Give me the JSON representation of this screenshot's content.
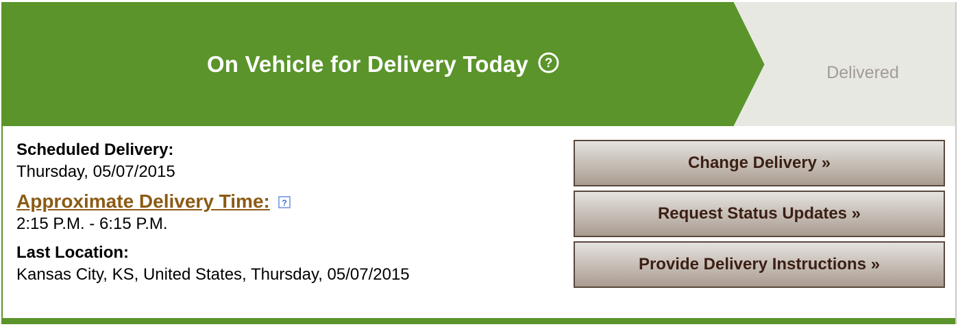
{
  "progress": {
    "current_status": "On Vehicle for Delivery Today",
    "next_status": "Delivered"
  },
  "details": {
    "scheduled_delivery_label": "Scheduled Delivery:",
    "scheduled_delivery_value": "Thursday, 05/07/2015",
    "approximate_time_label": "Approximate Delivery Time:",
    "approximate_time_value": "2:15 P.M. - 6:15 P.M.",
    "last_location_label": "Last Location:",
    "last_location_value": "Kansas City, KS, United States, Thursday, 05/07/2015"
  },
  "actions": {
    "change_delivery": "Change Delivery »",
    "request_status_updates": "Request Status Updates »",
    "provide_delivery_instructions": "Provide Delivery Instructions »"
  },
  "icons": {
    "status_help": "help-circle-icon",
    "time_help": "help-square-icon"
  },
  "colors": {
    "active_green": "#5a942a",
    "inactive_gray": "#e8e8e3",
    "link_brown": "#8b5a14",
    "button_text": "#3b1f14"
  }
}
